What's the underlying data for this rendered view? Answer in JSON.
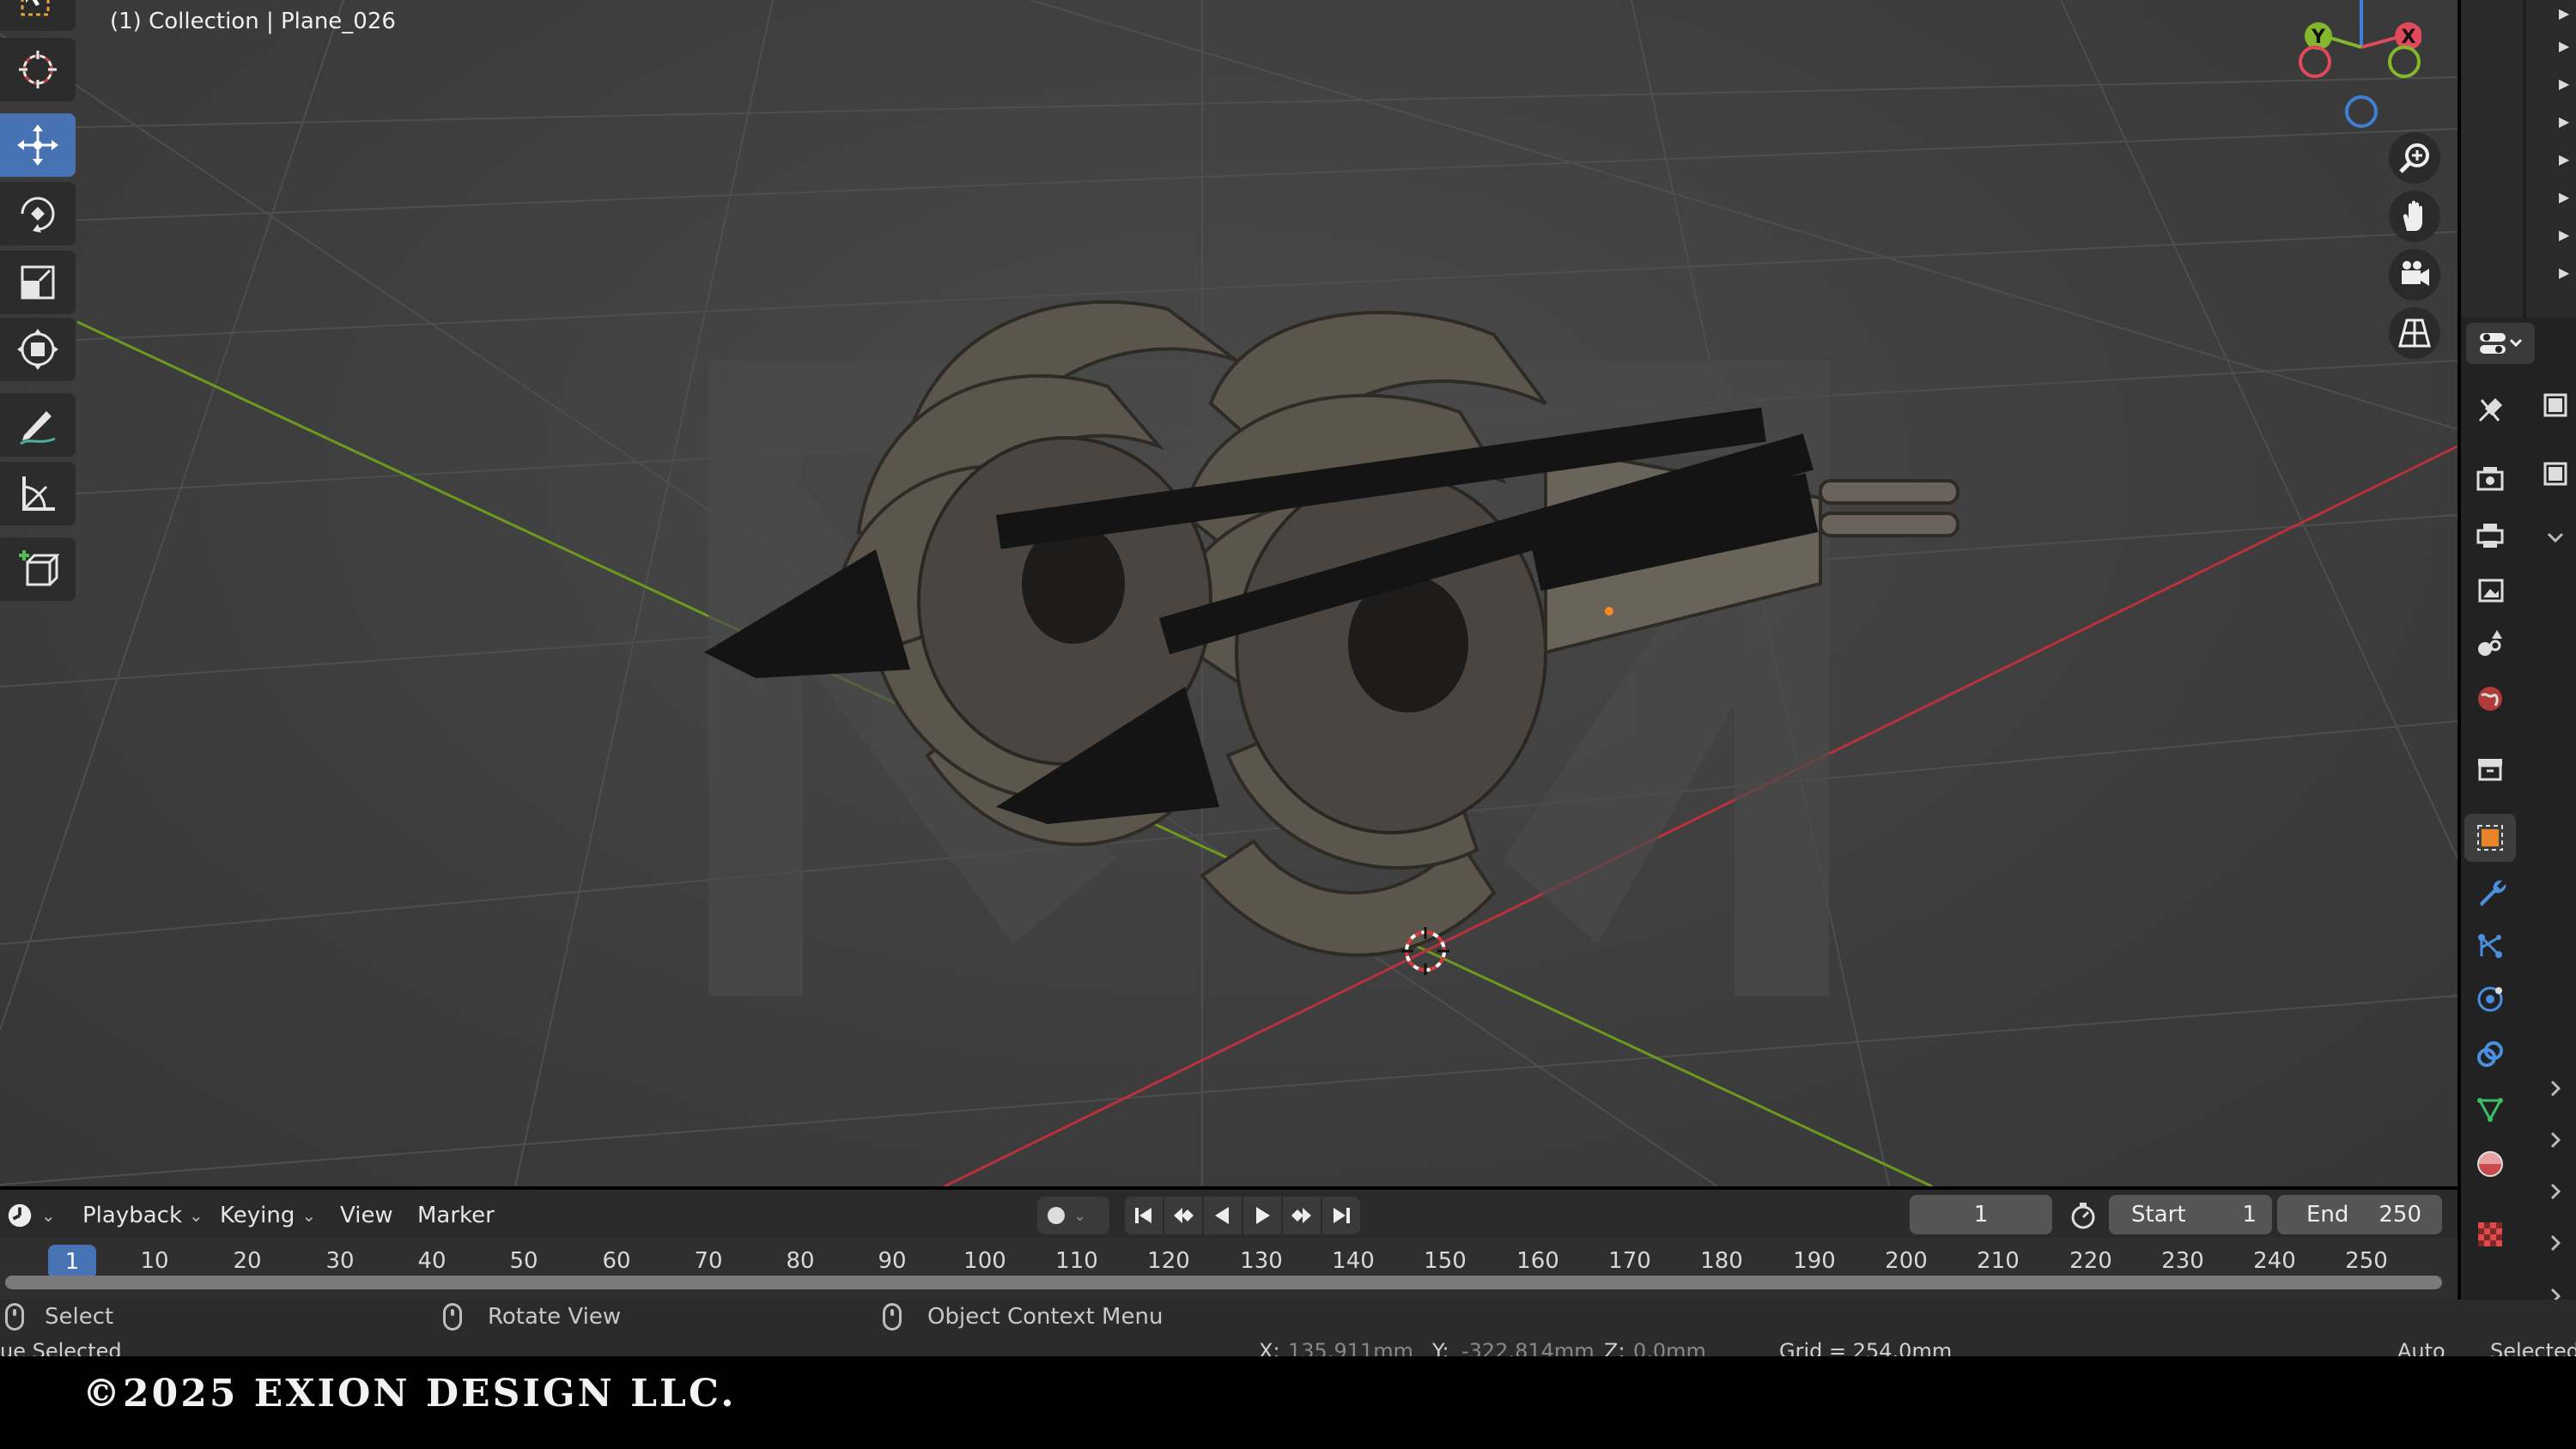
{
  "viewport": {
    "title": "(1) Collection | Plane_026"
  },
  "toolbar": {
    "tools": [
      {
        "name": "select-box-tool",
        "icon": "select-box-icon",
        "active": false
      },
      {
        "name": "cursor-tool",
        "icon": "cursor-icon",
        "active": false
      },
      {
        "name": "move-tool",
        "icon": "move-icon",
        "active": true
      },
      {
        "name": "rotate-tool",
        "icon": "rotate-icon",
        "active": false
      },
      {
        "name": "scale-tool",
        "icon": "scale-icon",
        "active": false
      },
      {
        "name": "transform-tool",
        "icon": "transform-icon",
        "active": false
      },
      {
        "name": "annotate-tool",
        "icon": "annotate-icon",
        "active": false
      },
      {
        "name": "measure-tool",
        "icon": "measure-icon",
        "active": false
      },
      {
        "name": "add-cube-tool",
        "icon": "add-cube-icon",
        "active": false
      }
    ]
  },
  "gizmo": {
    "x_label": "X",
    "y_label": "Y",
    "colors": {
      "x": "#e04a5a",
      "y": "#84b82c",
      "z": "#3f7fd6"
    }
  },
  "timeline": {
    "menus": {
      "playback": "Playback",
      "keying": "Keying",
      "view": "View",
      "marker": "Marker"
    },
    "current_frame": "1",
    "start_label": "Start",
    "start_value": "1",
    "end_label": "End",
    "end_value": "250",
    "ruler_badge": "1",
    "ticks": [
      "10",
      "20",
      "30",
      "40",
      "50",
      "60",
      "70",
      "80",
      "90",
      "100",
      "110",
      "120",
      "130",
      "140",
      "150",
      "160",
      "170",
      "180",
      "190",
      "200",
      "210",
      "220",
      "230",
      "240",
      "250"
    ]
  },
  "statusbar": {
    "select": "Select",
    "rotate_view": "Rotate View",
    "context_menu": "Object Context Menu",
    "selected_left": "ue Selected",
    "x_label": "X:",
    "x_value": "135.911mm",
    "y_label": "Y:",
    "y_value": "-322.814mm",
    "z_label": "Z:",
    "z_value": "0.0mm",
    "grid": "Grid = 254.0mm",
    "auto": "Auto",
    "selected_right": "Selected"
  },
  "copyright": "©2025 EXION DESIGN LLC.",
  "colors": {
    "active_blue": "#4772b3",
    "axis_red": "#b8323c",
    "axis_green": "#6c9a1e",
    "panel": "#2a2a2a"
  }
}
